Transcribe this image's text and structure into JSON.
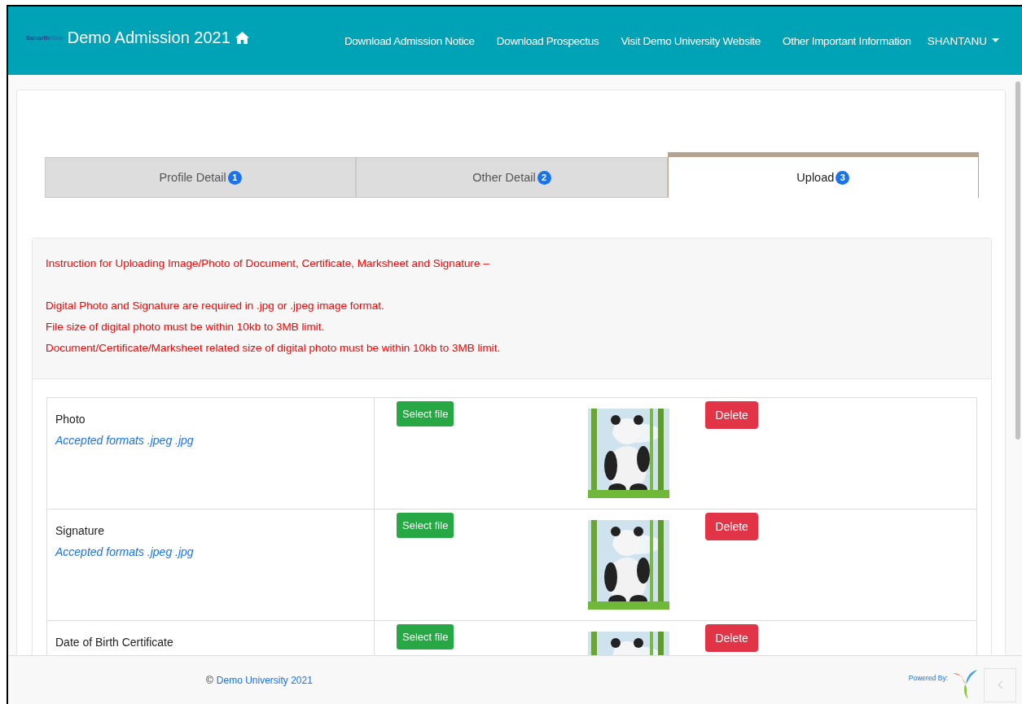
{
  "brand": {
    "logo_main": "Samarth",
    "logo_sub": "eGov",
    "title": "Demo Admission 2021"
  },
  "nav": [
    "Download Admission Notice",
    "Download Prospectus",
    "Visit Demo University Website",
    "Other Important Information"
  ],
  "user": {
    "name": "SHANTANU"
  },
  "tabs": [
    {
      "label": "Profile Detail",
      "badge": "1",
      "selected": false
    },
    {
      "label": "Other Detail",
      "badge": "2",
      "selected": false
    },
    {
      "label": "Upload",
      "badge": "3",
      "selected": true
    }
  ],
  "instructions": {
    "heading": "Instruction for Uploading Image/Photo of Document, Certificate, Marksheet and Signature –",
    "lines": [
      "Digital Photo and Signature are required in .jpg or .jpeg image format.",
      "File size of digital photo must be within 10kb to 3MB limit.",
      "Document/Certificate/Marksheet related size of digital photo must be within 10kb to 3MB limit."
    ]
  },
  "uploads": [
    {
      "label": "Photo",
      "hint": "Accepted formats .jpeg .jpg",
      "select": "Select file",
      "delete": "Delete"
    },
    {
      "label": "Signature",
      "hint": "Accepted formats .jpeg .jpg",
      "select": "Select file",
      "delete": "Delete"
    },
    {
      "label": "Date of Birth Certificate",
      "select": "Select file",
      "delete": "Delete"
    }
  ],
  "footer": {
    "copyright": "©",
    "org": "Demo University 2021",
    "powered": "Powered By:"
  }
}
